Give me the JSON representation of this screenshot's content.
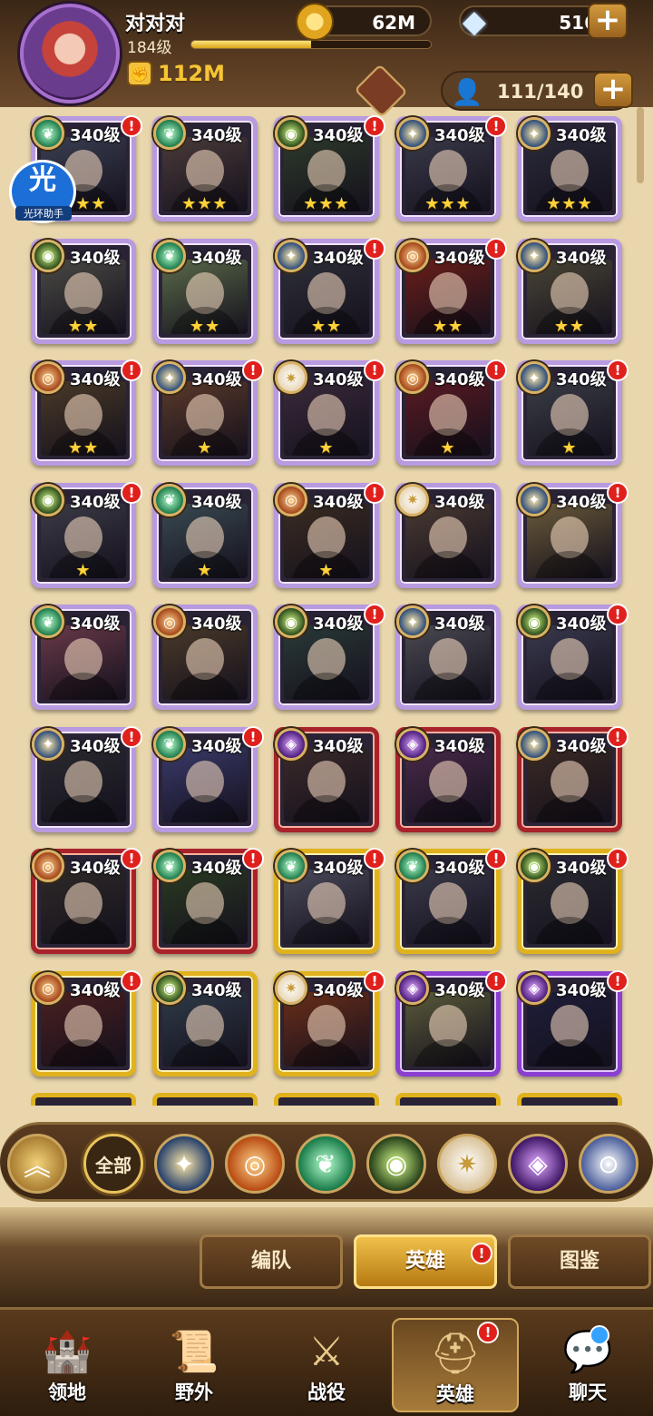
{
  "player": {
    "name": "对对对",
    "level": "184级",
    "xp_progress": 0.5,
    "power": "112M"
  },
  "currency": {
    "gold": "62M",
    "diamonds": "516"
  },
  "roster": {
    "count": "111/140"
  },
  "assistant": {
    "icon_text": "光",
    "label": "光环助手"
  },
  "heroes": [
    {
      "level": "340级",
      "stars": "★★★",
      "faction": "forest",
      "tier": "purple",
      "alert": true,
      "bg": "#3a3f52"
    },
    {
      "level": "340级",
      "stars": "★★★",
      "faction": "forest",
      "tier": "purple",
      "alert": false,
      "bg": "#4a3b3a"
    },
    {
      "level": "340级",
      "stars": "★★★",
      "faction": "grave",
      "tier": "purple",
      "alert": true,
      "bg": "#2d3a2a"
    },
    {
      "level": "340级",
      "stars": "★★★",
      "faction": "light",
      "tier": "purple",
      "alert": true,
      "bg": "#3a3a4a"
    },
    {
      "level": "340级",
      "stars": "★★★",
      "faction": "light",
      "tier": "purple",
      "alert": false,
      "bg": "#2a2a38"
    },
    {
      "level": "340级",
      "stars": "★★",
      "faction": "grave",
      "tier": "purple",
      "alert": false,
      "bg": "#4a4a44"
    },
    {
      "level": "340级",
      "stars": "★★",
      "faction": "forest",
      "tier": "purple",
      "alert": false,
      "bg": "#5a6a4a"
    },
    {
      "level": "340级",
      "stars": "★★",
      "faction": "light",
      "tier": "purple",
      "alert": true,
      "bg": "#2e2f38"
    },
    {
      "level": "340级",
      "stars": "★★",
      "faction": "maul",
      "tier": "purple",
      "alert": true,
      "bg": "#6a1e1a"
    },
    {
      "level": "340级",
      "stars": "★★",
      "faction": "light",
      "tier": "purple",
      "alert": false,
      "bg": "#4a4536"
    },
    {
      "level": "340级",
      "stars": "★★",
      "faction": "maul",
      "tier": "purple",
      "alert": true,
      "bg": "#4a3a28"
    },
    {
      "level": "340级",
      "stars": "★",
      "faction": "light",
      "tier": "purple",
      "alert": true,
      "bg": "#5a3a2a"
    },
    {
      "level": "340级",
      "stars": "★",
      "faction": "celestial",
      "tier": "purple",
      "alert": true,
      "bg": "#3a2a3a"
    },
    {
      "level": "340级",
      "stars": "★",
      "faction": "maul",
      "tier": "purple",
      "alert": true,
      "bg": "#5a1a22"
    },
    {
      "level": "340级",
      "stars": "★",
      "faction": "light",
      "tier": "purple",
      "alert": true,
      "bg": "#3a3d46"
    },
    {
      "level": "340级",
      "stars": "★",
      "faction": "grave",
      "tier": "purple",
      "alert": true,
      "bg": "#3b3b46"
    },
    {
      "level": "340级",
      "stars": "★",
      "faction": "forest",
      "tier": "purple",
      "alert": false,
      "bg": "#3a4a52"
    },
    {
      "level": "340级",
      "stars": "★",
      "faction": "maul",
      "tier": "purple",
      "alert": true,
      "bg": "#3a2c22"
    },
    {
      "level": "340级",
      "stars": "",
      "faction": "celestial",
      "tier": "purple",
      "alert": false,
      "bg": "#4a3a32"
    },
    {
      "level": "340级",
      "stars": "",
      "faction": "light",
      "tier": "purple",
      "alert": true,
      "bg": "#6a5a3a"
    },
    {
      "level": "340级",
      "stars": "",
      "faction": "forest",
      "tier": "purple",
      "alert": false,
      "bg": "#6a3a4a"
    },
    {
      "level": "340级",
      "stars": "",
      "faction": "maul",
      "tier": "purple",
      "alert": false,
      "bg": "#4a3a2a"
    },
    {
      "level": "340级",
      "stars": "",
      "faction": "grave",
      "tier": "purple",
      "alert": true,
      "bg": "#2a3a38"
    },
    {
      "level": "340级",
      "stars": "",
      "faction": "light",
      "tier": "purple",
      "alert": false,
      "bg": "#4a4a52"
    },
    {
      "level": "340级",
      "stars": "",
      "faction": "grave",
      "tier": "purple",
      "alert": true,
      "bg": "#3a3a4e"
    },
    {
      "level": "340级",
      "stars": "",
      "faction": "light",
      "tier": "purple",
      "alert": true,
      "bg": "#2a2a30"
    },
    {
      "level": "340级",
      "stars": "",
      "faction": "forest",
      "tier": "purple",
      "alert": true,
      "bg": "#3a3a6a"
    },
    {
      "level": "340级",
      "stars": "",
      "faction": "hypo",
      "tier": "red",
      "alert": false,
      "bg": "#3a2a2a"
    },
    {
      "level": "340级",
      "stars": "",
      "faction": "hypo",
      "tier": "red",
      "alert": false,
      "bg": "#4a2a4a"
    },
    {
      "level": "340级",
      "stars": "",
      "faction": "light",
      "tier": "red",
      "alert": true,
      "bg": "#3a2a24"
    },
    {
      "level": "340级",
      "stars": "",
      "faction": "maul",
      "tier": "red",
      "alert": true,
      "bg": "#2e2a28"
    },
    {
      "level": "340级",
      "stars": "",
      "faction": "forest",
      "tier": "red",
      "alert": true,
      "bg": "#2a3a22"
    },
    {
      "level": "340级",
      "stars": "",
      "faction": "forest",
      "tier": "gold",
      "alert": true,
      "bg": "#4a4a5a"
    },
    {
      "level": "340级",
      "stars": "",
      "faction": "forest",
      "tier": "gold",
      "alert": true,
      "bg": "#3a3a4a"
    },
    {
      "level": "340级",
      "stars": "",
      "faction": "grave",
      "tier": "gold",
      "alert": true,
      "bg": "#2a2a30"
    },
    {
      "level": "340级",
      "stars": "",
      "faction": "maul",
      "tier": "gold",
      "alert": true,
      "bg": "#4a2020"
    },
    {
      "level": "340级",
      "stars": "",
      "faction": "grave",
      "tier": "gold",
      "alert": false,
      "bg": "#2e3a48"
    },
    {
      "level": "340级",
      "stars": "",
      "faction": "celestial",
      "tier": "gold",
      "alert": true,
      "bg": "#6a2e1a"
    },
    {
      "level": "340级",
      "stars": "",
      "faction": "hypo",
      "tier": "violet",
      "alert": true,
      "bg": "#5a5a3a"
    },
    {
      "level": "340级",
      "stars": "",
      "faction": "hypo",
      "tier": "violet",
      "alert": true,
      "bg": "#1e1e3a"
    }
  ],
  "filters": {
    "collapse_icon": "chevron-up",
    "all_label": "全部",
    "factions": [
      "lightbearer",
      "mauler",
      "wilder",
      "graveborn",
      "celestial",
      "hypogean",
      "dimensional"
    ]
  },
  "subtabs": [
    {
      "label": "编队",
      "active": false,
      "alert": false
    },
    {
      "label": "英雄",
      "active": true,
      "alert": true
    },
    {
      "label": "图鉴",
      "active": false,
      "alert": false
    }
  ],
  "nav": [
    {
      "label": "领地",
      "icon": "castle",
      "active": false,
      "alert": false,
      "dot": false
    },
    {
      "label": "野外",
      "icon": "map-scroll",
      "active": false,
      "alert": false,
      "dot": false
    },
    {
      "label": "战役",
      "icon": "crossed-swords",
      "active": false,
      "alert": false,
      "dot": false
    },
    {
      "label": "英雄",
      "icon": "helmet",
      "active": true,
      "alert": true,
      "dot": false
    },
    {
      "label": "聊天",
      "icon": "chat",
      "active": false,
      "alert": false,
      "dot": true
    }
  ],
  "alert_glyph": "!"
}
